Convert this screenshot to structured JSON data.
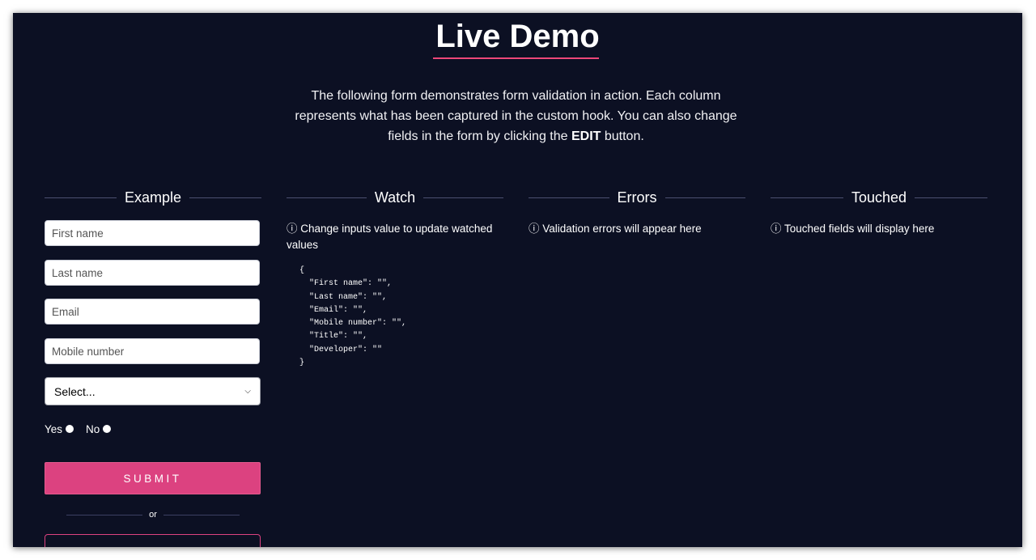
{
  "page": {
    "title": "Live Demo",
    "intro_before": "The following form demonstrates form validation in action. Each column represents what has been captured in the custom hook. You can also change fields in the form by clicking the ",
    "intro_bold": "EDIT",
    "intro_after": " button."
  },
  "columns": {
    "example": {
      "heading": "Example"
    },
    "watch": {
      "heading": "Watch",
      "hint": "ⓘ Change inputs value to update watched values"
    },
    "errors": {
      "heading": "Errors",
      "hint": "ⓘ Validation errors will appear here"
    },
    "touched": {
      "heading": "Touched",
      "hint": "ⓘ Touched fields will display here"
    }
  },
  "form": {
    "first_name": {
      "placeholder": "First name",
      "value": ""
    },
    "last_name": {
      "placeholder": "Last name",
      "value": ""
    },
    "email": {
      "placeholder": "Email",
      "value": ""
    },
    "mobile": {
      "placeholder": "Mobile number",
      "value": ""
    },
    "title_select": {
      "selected": "Select..."
    },
    "developer_options": [
      {
        "label": "Yes"
      },
      {
        "label": "No"
      }
    ],
    "submit_label": "SUBMIT",
    "or_label": "or"
  },
  "watch_json": "{\n  \"First name\": \"\",\n  \"Last name\": \"\",\n  \"Email\": \"\",\n  \"Mobile number\": \"\",\n  \"Title\": \"\",\n  \"Developer\": \"\"\n}",
  "icons": {
    "info": "info-icon",
    "select_chevron": "chevron-down-icon",
    "radio": "radio-icon"
  },
  "colors": {
    "background": "#0c1023",
    "accent": "#dc4280",
    "text": "#ffffff"
  }
}
